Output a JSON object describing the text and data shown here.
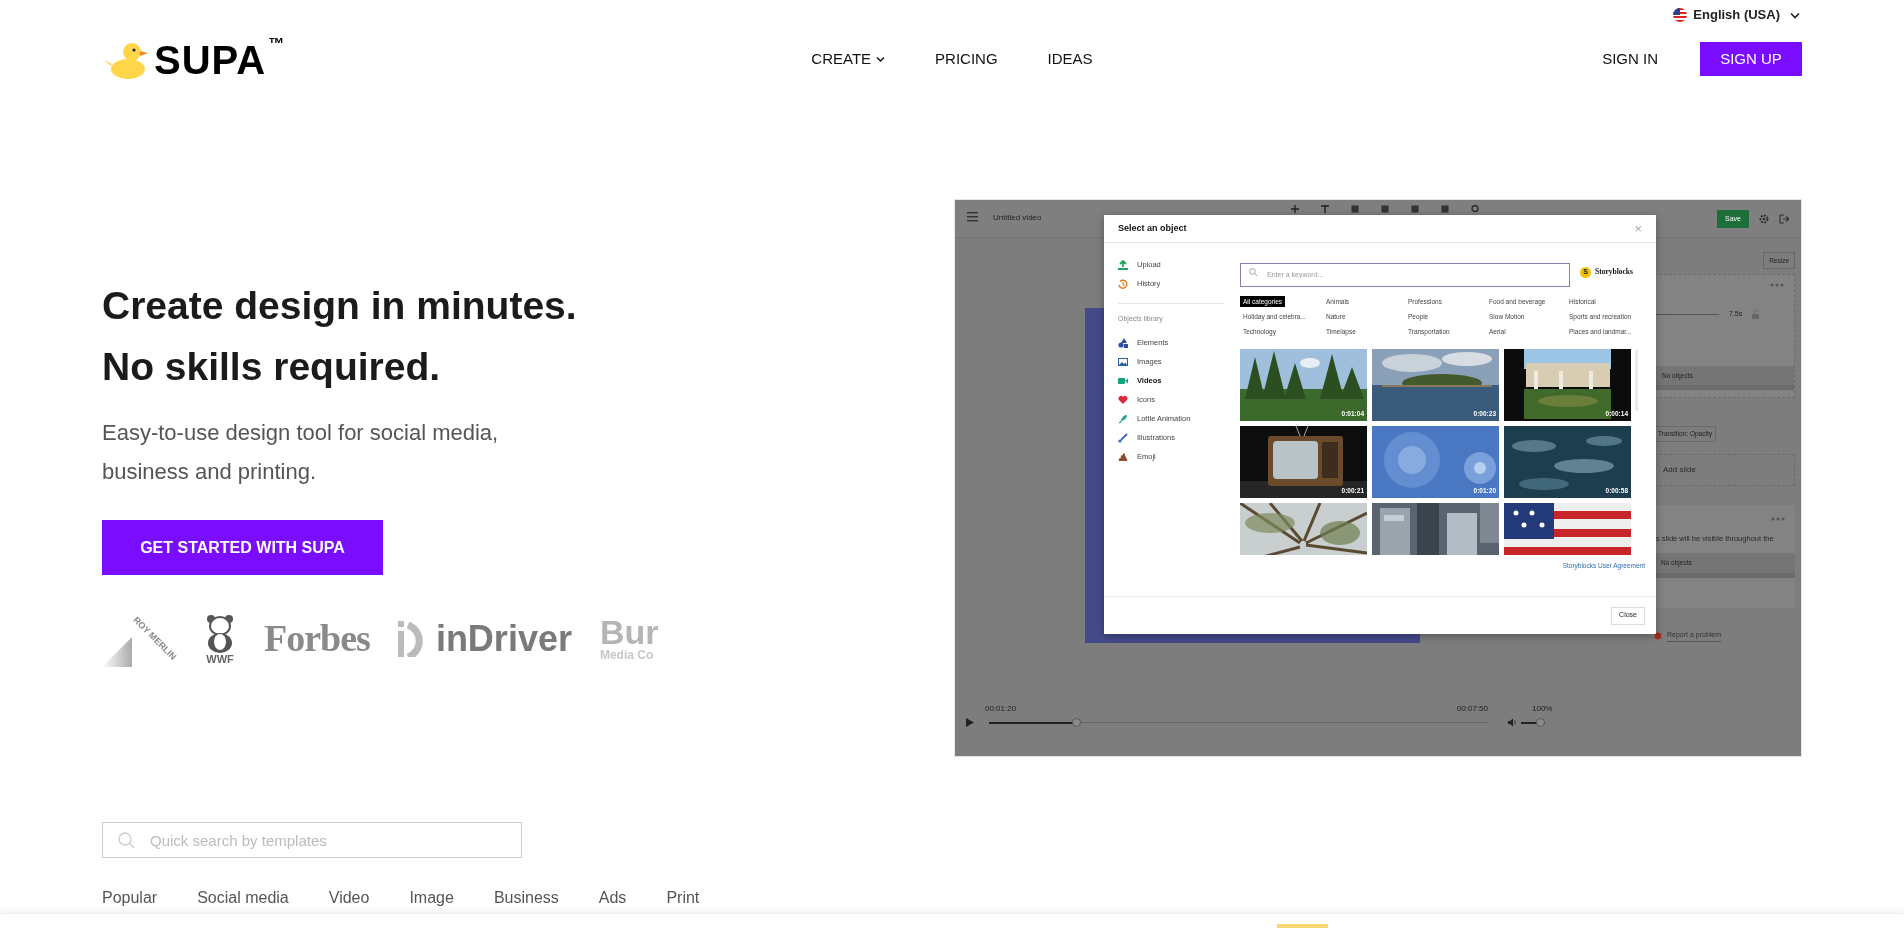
{
  "language": {
    "label": "English (USA)"
  },
  "logo": {
    "name": "SUPA",
    "trademark": "™"
  },
  "nav": [
    {
      "label": "CREATE",
      "has_menu": true
    },
    {
      "label": "PRICING",
      "has_menu": false
    },
    {
      "label": "IDEAS",
      "has_menu": false
    }
  ],
  "auth": {
    "sign_in": "SIGN IN",
    "sign_up": "SIGN UP"
  },
  "hero": {
    "title_lines": [
      "Create design in minutes.",
      "No skills required."
    ],
    "subtitle_lines": [
      "Easy-to-use design tool for social media,",
      "business and printing."
    ],
    "cta": "GET STARTED WITH SUPA"
  },
  "client_logos": [
    {
      "kind": "triangle",
      "text": "ROY MERLIN"
    },
    {
      "kind": "bear",
      "text": "WWF"
    },
    {
      "kind": "serif",
      "text": "Forbes"
    },
    {
      "kind": "mark",
      "text": "inDriver"
    },
    {
      "kind": "stacked",
      "text": "Bur",
      "subtext": "Media Co"
    }
  ],
  "editor_preview": {
    "title": "Untitled video",
    "save": "Save",
    "resize": "Resize",
    "duration": "7.5s",
    "slide_objects": "No objects",
    "transition": "Transition: Opacity",
    "add_slide": "Add slide",
    "global_note": "s slide will be visible throughout the",
    "global_objects": "No objects",
    "report": "Report a problem",
    "player": {
      "current": "00:01:20",
      "total": "00:07:50",
      "progress": {
        "level": 0.17
      },
      "volume": {
        "reading": "100%",
        "level": 1
      }
    },
    "dialog": {
      "title": "Select an object",
      "close_mark": "×",
      "sources": [
        {
          "kind": "upload",
          "label": "Upload"
        },
        {
          "kind": "history",
          "label": "History"
        }
      ],
      "library_heading": "Objects library",
      "library": [
        {
          "kind": "elements",
          "label": "Elements",
          "selected": false
        },
        {
          "kind": "images",
          "label": "Images",
          "selected": false
        },
        {
          "kind": "videos",
          "label": "Videos",
          "selected": true
        },
        {
          "kind": "icons",
          "label": "Icons",
          "selected": false
        },
        {
          "kind": "lottie",
          "label": "Lottie Animation",
          "selected": false
        },
        {
          "kind": "illustrations",
          "label": "Illustrations",
          "selected": false
        },
        {
          "kind": "emoji",
          "label": "Emoji",
          "selected": false
        }
      ],
      "search_placeholder": "Enter a keyword...",
      "provider_mark": "S",
      "provider": "Storyblocks",
      "categories": [
        {
          "label": "All categories",
          "selected": true
        },
        {
          "label": "Animals",
          "selected": false
        },
        {
          "label": "Professions",
          "selected": false
        },
        {
          "label": "Food and beverage",
          "selected": false
        },
        {
          "label": "Historical",
          "selected": false
        },
        {
          "label": "Holiday and celebra...",
          "selected": false
        },
        {
          "label": "Nature",
          "selected": false
        },
        {
          "label": "People",
          "selected": false
        },
        {
          "label": "Slow Motion",
          "selected": false
        },
        {
          "label": "Sports and recreation",
          "selected": false
        },
        {
          "label": "Technology",
          "selected": false
        },
        {
          "label": "Timelapse",
          "selected": false
        },
        {
          "label": "Transportation",
          "selected": false
        },
        {
          "label": "Aerial",
          "selected": false
        },
        {
          "label": "Places and landmar...",
          "selected": false
        }
      ],
      "videos": [
        {
          "kind": "picture",
          "duration": "0:01:04"
        },
        {
          "kind": "picture",
          "duration": "0:00:23"
        },
        {
          "kind": "picture",
          "duration": "0:00:14"
        },
        {
          "kind": "picture",
          "duration": "0:00:21"
        },
        {
          "kind": "picture",
          "duration": "0:01:20"
        },
        {
          "kind": "picture",
          "duration": "0:00:58"
        },
        {
          "kind": "picture"
        },
        {
          "kind": "picture"
        },
        {
          "kind": "picture"
        }
      ],
      "agreement": "Storyblocks User Agreement",
      "close": "Close"
    }
  },
  "template_search": {
    "placeholder": "Quick search by templates"
  },
  "template_tabs": [
    {
      "label": "Popular"
    },
    {
      "label": "Social media"
    },
    {
      "label": "Video"
    },
    {
      "label": "Image"
    },
    {
      "label": "Business"
    },
    {
      "label": "Ads"
    },
    {
      "label": "Print"
    }
  ]
}
